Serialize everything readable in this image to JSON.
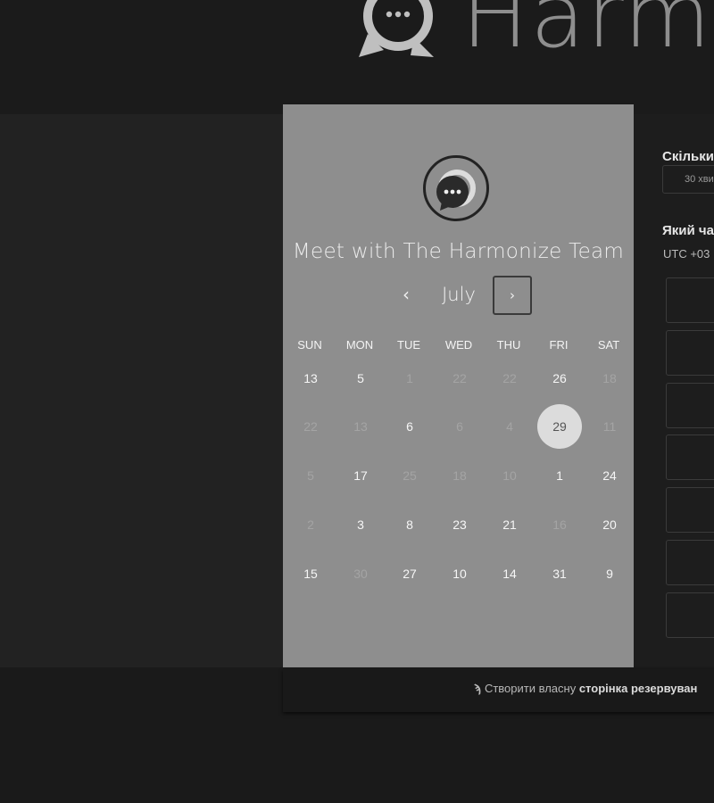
{
  "header": {
    "brand_text": "Harmo"
  },
  "calendar": {
    "meeting_title": "Meet with The Harmonize Team",
    "month": "July",
    "prev_icon": "‹",
    "next_icon": "›",
    "weekdays": [
      "SUN",
      "MON",
      "TUE",
      "WED",
      "THU",
      "FRI",
      "SAT"
    ],
    "weeks": [
      [
        {
          "d": "13",
          "s": "on"
        },
        {
          "d": "5",
          "s": "on"
        },
        {
          "d": "1",
          "s": "off"
        },
        {
          "d": "22",
          "s": "off"
        },
        {
          "d": "22",
          "s": "off"
        },
        {
          "d": "26",
          "s": "on"
        },
        {
          "d": "18",
          "s": "off"
        }
      ],
      [
        {
          "d": "22",
          "s": "off"
        },
        {
          "d": "13",
          "s": "off"
        },
        {
          "d": "6",
          "s": "on"
        },
        {
          "d": "6",
          "s": "off"
        },
        {
          "d": "4",
          "s": "off"
        },
        {
          "d": "29",
          "s": "sel"
        },
        {
          "d": "11",
          "s": "off"
        }
      ],
      [
        {
          "d": "5",
          "s": "off"
        },
        {
          "d": "17",
          "s": "on"
        },
        {
          "d": "25",
          "s": "off"
        },
        {
          "d": "18",
          "s": "off"
        },
        {
          "d": "10",
          "s": "off"
        },
        {
          "d": "1",
          "s": "on"
        },
        {
          "d": "24",
          "s": "on"
        }
      ],
      [
        {
          "d": "2",
          "s": "off"
        },
        {
          "d": "3",
          "s": "on"
        },
        {
          "d": "8",
          "s": "on"
        },
        {
          "d": "23",
          "s": "on"
        },
        {
          "d": "21",
          "s": "on"
        },
        {
          "d": "16",
          "s": "off"
        },
        {
          "d": "20",
          "s": "on"
        }
      ],
      [
        {
          "d": "15",
          "s": "on"
        },
        {
          "d": "30",
          "s": "off"
        },
        {
          "d": "27",
          "s": "on"
        },
        {
          "d": "10",
          "s": "on"
        },
        {
          "d": "14",
          "s": "on"
        },
        {
          "d": "31",
          "s": "on"
        },
        {
          "d": "9",
          "s": "on"
        }
      ]
    ]
  },
  "scheduler": {
    "duration_question": "Скільки",
    "duration_value": "30 хви",
    "time_question": "Який ча",
    "timezone": "UTC +03",
    "slot_count": 7
  },
  "footer": {
    "text_prefix": "Створити власну",
    "text_bold": "сторінка резервуван"
  }
}
